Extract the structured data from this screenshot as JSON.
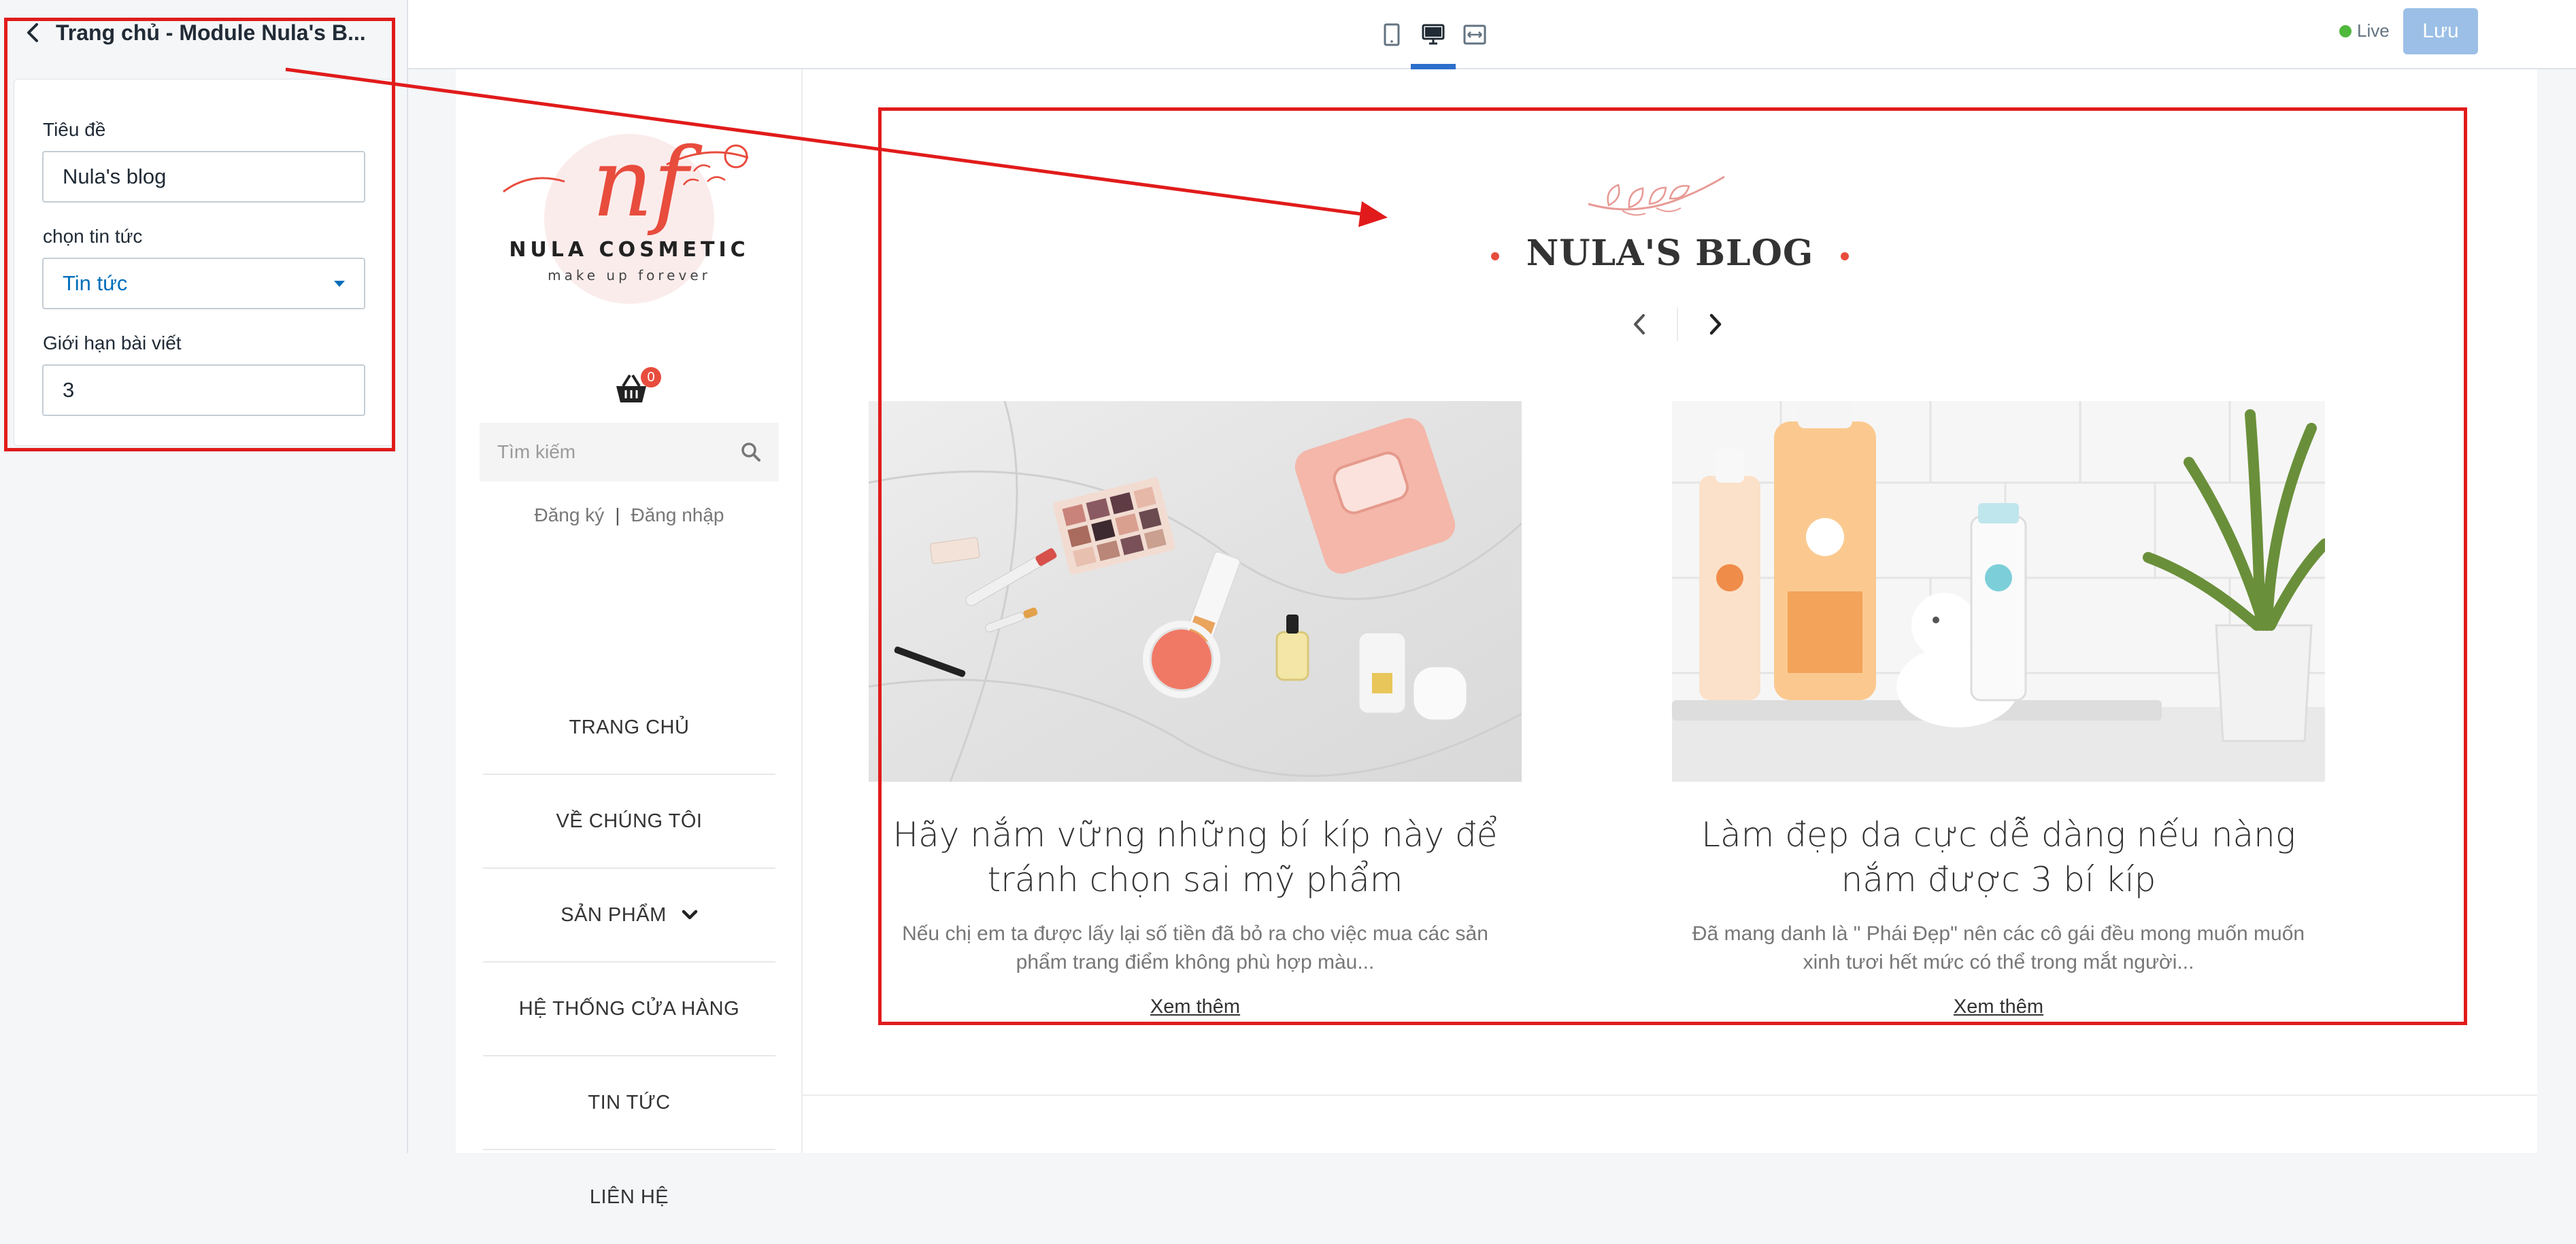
{
  "panel": {
    "title": "Trang chủ - Module Nula's B...",
    "fields": {
      "title_label": "Tiêu đề",
      "title_value": "Nula's blog",
      "news_label": "chọn tin tức",
      "news_value": "Tin tức",
      "limit_label": "Giới hạn bài viết",
      "limit_value": "3"
    }
  },
  "topbar": {
    "view_icons": [
      "mobile-icon",
      "desktop-icon",
      "fullwidth-icon"
    ],
    "live_label": "Live",
    "save_label": "Lưu",
    "colors": {
      "live": "#50b83c",
      "save": "#9bbfe6",
      "active_underline": "#2c6ecb"
    }
  },
  "site": {
    "logo": {
      "text": "NULA COSMETIC",
      "tagline": "make up forever",
      "monogram": "nf"
    },
    "cart_count": "0",
    "search_placeholder": "Tìm kiếm",
    "auth": {
      "register": "Đăng ký",
      "separator": "|",
      "login": "Đăng nhập"
    },
    "nav": [
      {
        "label": "TRANG CHỦ"
      },
      {
        "label": "VỀ CHÚNG TÔI"
      },
      {
        "label": "SẢN PHẨM"
      },
      {
        "label": "HỆ THỐNG CỬA HÀNG"
      },
      {
        "label": "TIN TỨC"
      },
      {
        "label": "LIÊN HỆ"
      }
    ],
    "blog": {
      "title": "NULA'S BLOG",
      "accent_color": "#e84c3d",
      "posts": [
        {
          "title": "Hãy nắm vững những bí kíp này để tránh chọn sai mỹ phẩm",
          "excerpt": "Nếu chị em ta được lấy lại số tiền đã bỏ ra cho việc mua các sản phẩm trang điểm không phù hợp màu...",
          "more": "Xem thêm"
        },
        {
          "title": "Làm đẹp da cực dễ dàng nếu nàng nắm được 3 bí kíp",
          "excerpt": "Đã mang danh là \" Phái Đẹp\" nên các cô gái đều mong muốn muốn xinh tươi hết mức có thể trong mắt người...",
          "more": "Xem thêm"
        }
      ]
    }
  },
  "annotation_color": "#e11b1b"
}
